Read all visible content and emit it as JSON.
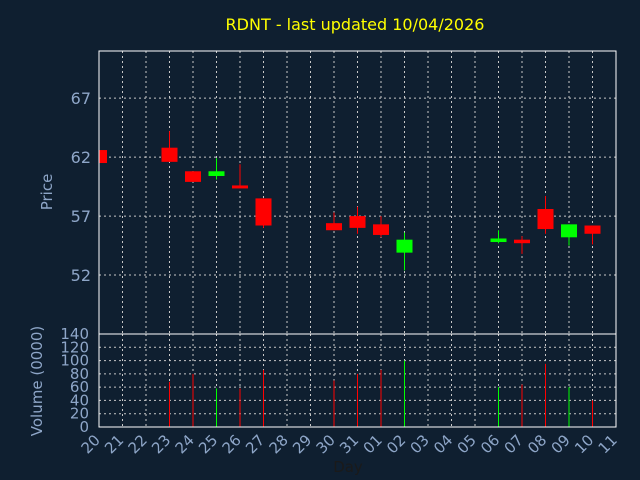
{
  "colors": {
    "background": "#0f1f30",
    "axis": "#ffffff",
    "grid": "#c8c8c8",
    "title": "#ffff00",
    "label": "#8ea6c8",
    "up": "#00ff00",
    "down": "#ff0000"
  },
  "chart_data": [
    {
      "type": "candlestick",
      "title": "RDNT - last updated 10/04/2026",
      "xlabel": "",
      "ylabel": "Price",
      "ylim": [
        47.0,
        71.0
      ],
      "yticks": [
        52,
        57,
        62,
        67
      ],
      "grid": true,
      "x": [
        "20",
        "21",
        "22",
        "23",
        "24",
        "25",
        "26",
        "27",
        "28",
        "29",
        "30",
        "31",
        "01",
        "02",
        "03",
        "04",
        "05",
        "06",
        "07",
        "08",
        "09",
        "10",
        "11"
      ],
      "candles": [
        {
          "x": "20",
          "open": 62.6,
          "high": 62.6,
          "low": 61.5,
          "close": 61.5
        },
        {
          "x": "23",
          "open": 62.8,
          "high": 64.2,
          "low": 61.6,
          "close": 61.6
        },
        {
          "x": "24",
          "open": 60.8,
          "high": 60.8,
          "low": 59.9,
          "close": 59.9
        },
        {
          "x": "25",
          "open": 60.4,
          "high": 61.9,
          "low": 60.1,
          "close": 60.8
        },
        {
          "x": "26",
          "open": 59.6,
          "high": 61.4,
          "low": 59.4,
          "close": 59.4
        },
        {
          "x": "27",
          "open": 58.5,
          "high": 58.5,
          "low": 56.0,
          "close": 56.2
        },
        {
          "x": "30",
          "open": 56.4,
          "high": 57.3,
          "low": 55.8,
          "close": 55.8
        },
        {
          "x": "31",
          "open": 57.0,
          "high": 57.8,
          "low": 55.5,
          "close": 56.0
        },
        {
          "x": "01",
          "open": 56.3,
          "high": 57.0,
          "low": 55.2,
          "close": 55.4
        },
        {
          "x": "02",
          "open": 53.9,
          "high": 55.6,
          "low": 52.4,
          "close": 55.0
        },
        {
          "x": "06",
          "open": 54.8,
          "high": 55.8,
          "low": 54.7,
          "close": 55.1
        },
        {
          "x": "07",
          "open": 55.0,
          "high": 55.3,
          "low": 53.8,
          "close": 54.7
        },
        {
          "x": "08",
          "open": 57.6,
          "high": 58.7,
          "low": 55.5,
          "close": 55.9
        },
        {
          "x": "09",
          "open": 55.2,
          "high": 56.3,
          "low": 54.5,
          "close": 56.3
        },
        {
          "x": "10",
          "open": 56.2,
          "high": 56.2,
          "low": 54.6,
          "close": 55.5
        }
      ]
    },
    {
      "type": "bar",
      "xlabel": "Day",
      "ylabel": "Volume (0000)",
      "ylim": [
        0,
        140
      ],
      "yticks": [
        0,
        20,
        40,
        60,
        80,
        100,
        120,
        140
      ],
      "grid": true,
      "categories": [
        "20",
        "21",
        "22",
        "23",
        "24",
        "25",
        "26",
        "27",
        "28",
        "29",
        "30",
        "31",
        "01",
        "02",
        "03",
        "04",
        "05",
        "06",
        "07",
        "08",
        "09",
        "10",
        "11"
      ],
      "bars": [
        {
          "x": "23",
          "value": 68,
          "direction": "down"
        },
        {
          "x": "24",
          "value": 80,
          "direction": "down"
        },
        {
          "x": "25",
          "value": 58,
          "direction": "up"
        },
        {
          "x": "26",
          "value": 58,
          "direction": "down"
        },
        {
          "x": "27",
          "value": 86,
          "direction": "down"
        },
        {
          "x": "30",
          "value": 70,
          "direction": "down"
        },
        {
          "x": "31",
          "value": 80,
          "direction": "down"
        },
        {
          "x": "01",
          "value": 86,
          "direction": "down"
        },
        {
          "x": "02",
          "value": 100,
          "direction": "up"
        },
        {
          "x": "06",
          "value": 60,
          "direction": "up"
        },
        {
          "x": "07",
          "value": 64,
          "direction": "down"
        },
        {
          "x": "08",
          "value": 95,
          "direction": "down"
        },
        {
          "x": "09",
          "value": 60,
          "direction": "up"
        },
        {
          "x": "10",
          "value": 40,
          "direction": "down"
        }
      ]
    }
  ]
}
